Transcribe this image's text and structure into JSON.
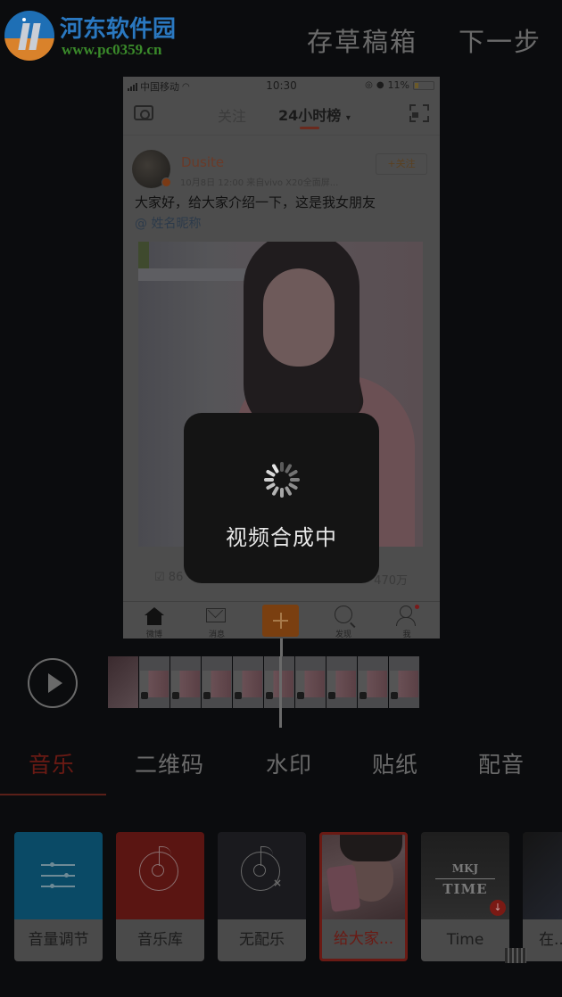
{
  "watermark": {
    "title": "河东软件园",
    "url": "www.pc0359.cn"
  },
  "header": {
    "save_draft_label": "存草稿箱",
    "next_step_label": "下一步"
  },
  "preview": {
    "statusbar": {
      "carrier": "中国移动",
      "time": "10:30",
      "battery": "11%"
    },
    "nav": {
      "follow_tab": "关注",
      "hot_tab": "24小时榜",
      "hot_tab_caret": "▾"
    },
    "post": {
      "author": "Dusite",
      "meta": "10月8日 12:00  来自vivo X20全面屏...",
      "follow_button": "+关注",
      "text": "大家好，给大家介绍一下，这是我女朋友",
      "mention": "@ 姓名昵称",
      "share_count": "86",
      "like_count": "470万"
    },
    "tabbar": [
      {
        "label": "微博",
        "icon": "home-icon"
      },
      {
        "label": "消息",
        "icon": "mail-icon"
      },
      {
        "label": "",
        "icon": "plus-icon"
      },
      {
        "label": "发现",
        "icon": "search-icon"
      },
      {
        "label": "我",
        "icon": "user-icon"
      }
    ]
  },
  "loading": {
    "text": "视频合成中"
  },
  "timeline": {
    "frame_count": 10
  },
  "categories": {
    "active_index": 0,
    "items": [
      "音乐",
      "二维码",
      "水印",
      "贴纸",
      "配音"
    ]
  },
  "music_cards": [
    {
      "label": "音量调节",
      "icon": "sliders-icon",
      "color": "#0a4a66"
    },
    {
      "label": "音乐库",
      "icon": "music-disc-icon",
      "color": "#5a1512"
    },
    {
      "label": "无配乐",
      "icon": "no-music-icon",
      "color": "#1a1a1e"
    },
    {
      "label": "给大家...",
      "icon": "cover-thumbnail",
      "selected": true
    },
    {
      "label": "Time",
      "cover_line1": "MKJ",
      "cover_line2": "TIME",
      "icon": "download-icon"
    },
    {
      "label": "在..."
    }
  ],
  "colors": {
    "accent": "#6a1a14",
    "background": "#0b0c0e"
  }
}
